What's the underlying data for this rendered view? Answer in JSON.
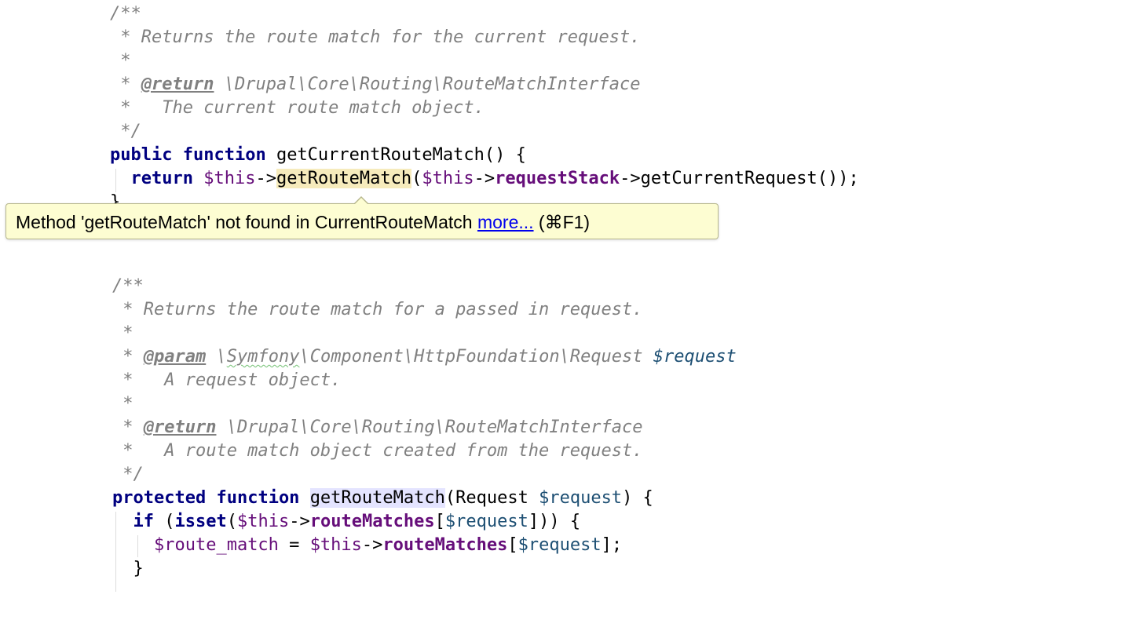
{
  "block1": {
    "lines": [
      "/**",
      " * Returns the route match for the current request.",
      " *",
      " * ",
      " *   The current route match object.",
      " */"
    ],
    "return_tag": "@return",
    "return_type": " \\Drupal\\Core\\Routing\\RouteMatchInterface",
    "sig_public": "public",
    "sig_function": "function",
    "sig_name": " getCurrentRouteMatch() {",
    "body_return": "return",
    "body_this1": " $this",
    "body_arrow1": "->",
    "body_method": "getRouteMatch",
    "body_paren": "(",
    "body_this2": "$this",
    "body_arrow2": "->",
    "body_field": "requestStack",
    "body_rest": "->getCurrentRequest());",
    "close_brace": "}"
  },
  "tooltip": {
    "message": "Method 'getRouteMatch' not found in CurrentRouteMatch ",
    "link": "more...",
    "shortcut": " (⌘F1)"
  },
  "block2": {
    "lines": [
      "/**",
      " * Returns the route match for a passed in request.",
      " *",
      " *   A request object.",
      " *",
      " *   A route match object created from the request.",
      " */"
    ],
    "param_prefix": " * ",
    "param_tag": "@param",
    "param_ns1": " \\",
    "param_symfony": "Symfony",
    "param_ns2": "\\Component\\HttpFoundation\\Request ",
    "param_var": "$request",
    "return_prefix": " * ",
    "return_tag": "@return",
    "return_type": " \\Drupal\\Core\\Routing\\RouteMatchInterface",
    "sig_protected": "protected",
    "sig_function": "function",
    "sig_space": " ",
    "sig_name": "getRouteMatch",
    "sig_open": "(Request ",
    "sig_var": "$request",
    "sig_close": ") {",
    "if_kw": "if",
    "if_open": " (",
    "isset_kw": "isset",
    "if_paren": "(",
    "if_this": "$this",
    "if_arrow": "->",
    "if_field": "routeMatches",
    "if_br": "[",
    "if_var": "$request",
    "if_close": "])) {",
    "assign_var": "$route_match",
    "assign_eq": " = ",
    "assign_this": "$this",
    "assign_arrow": "->",
    "assign_field": "routeMatches",
    "assign_br": "[",
    "assign_req": "$request",
    "assign_end": "];",
    "inner_close": "}"
  }
}
